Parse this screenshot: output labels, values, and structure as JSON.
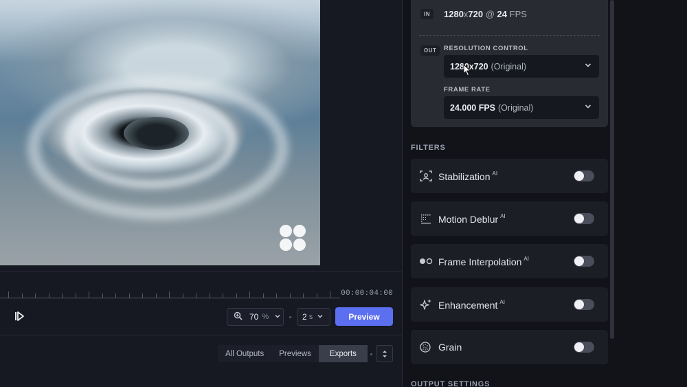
{
  "timeline": {
    "timecode": "00:00:04:00"
  },
  "controls": {
    "zoom_value": "70",
    "zoom_unit": "%",
    "step_value": "2",
    "step_unit": "s",
    "preview_label": "Preview"
  },
  "output_tabs": {
    "items": [
      "All Outputs",
      "Previews",
      "Exports"
    ],
    "active": "Exports"
  },
  "io": {
    "in_badge": "IN",
    "in_resolution": "1280",
    "in_x": "x",
    "in_resolution_h": "720",
    "in_at": " @ ",
    "in_fps_value": "24",
    "in_fps_unit": " FPS",
    "out_badge": "OUT",
    "resolution_label": "RESOLUTION CONTROL",
    "resolution_value": "1280x720",
    "resolution_note": "(Original)",
    "frame_rate_label": "FRAME RATE",
    "frame_rate_value": "24.000 FPS",
    "frame_rate_note": "(Original)"
  },
  "filters": {
    "title": "FILTERS",
    "items": [
      {
        "name": "Stabilization",
        "ai": "AI",
        "icon": "stabilization-icon",
        "enabled": false
      },
      {
        "name": "Motion Deblur",
        "ai": "AI",
        "icon": "motion-deblur-icon",
        "enabled": false
      },
      {
        "name": "Frame Interpolation",
        "ai": "AI",
        "icon": "frame-interpolation-icon",
        "enabled": false
      },
      {
        "name": "Enhancement",
        "ai": "AI",
        "icon": "sparkle-icon",
        "enabled": false
      },
      {
        "name": "Grain",
        "ai": "",
        "icon": "grain-icon",
        "enabled": false
      }
    ]
  },
  "output_settings": {
    "title": "OUTPUT SETTINGS"
  },
  "colors": {
    "accent": "#5b6ff0",
    "panel": "#292b33",
    "background": "#111319"
  }
}
